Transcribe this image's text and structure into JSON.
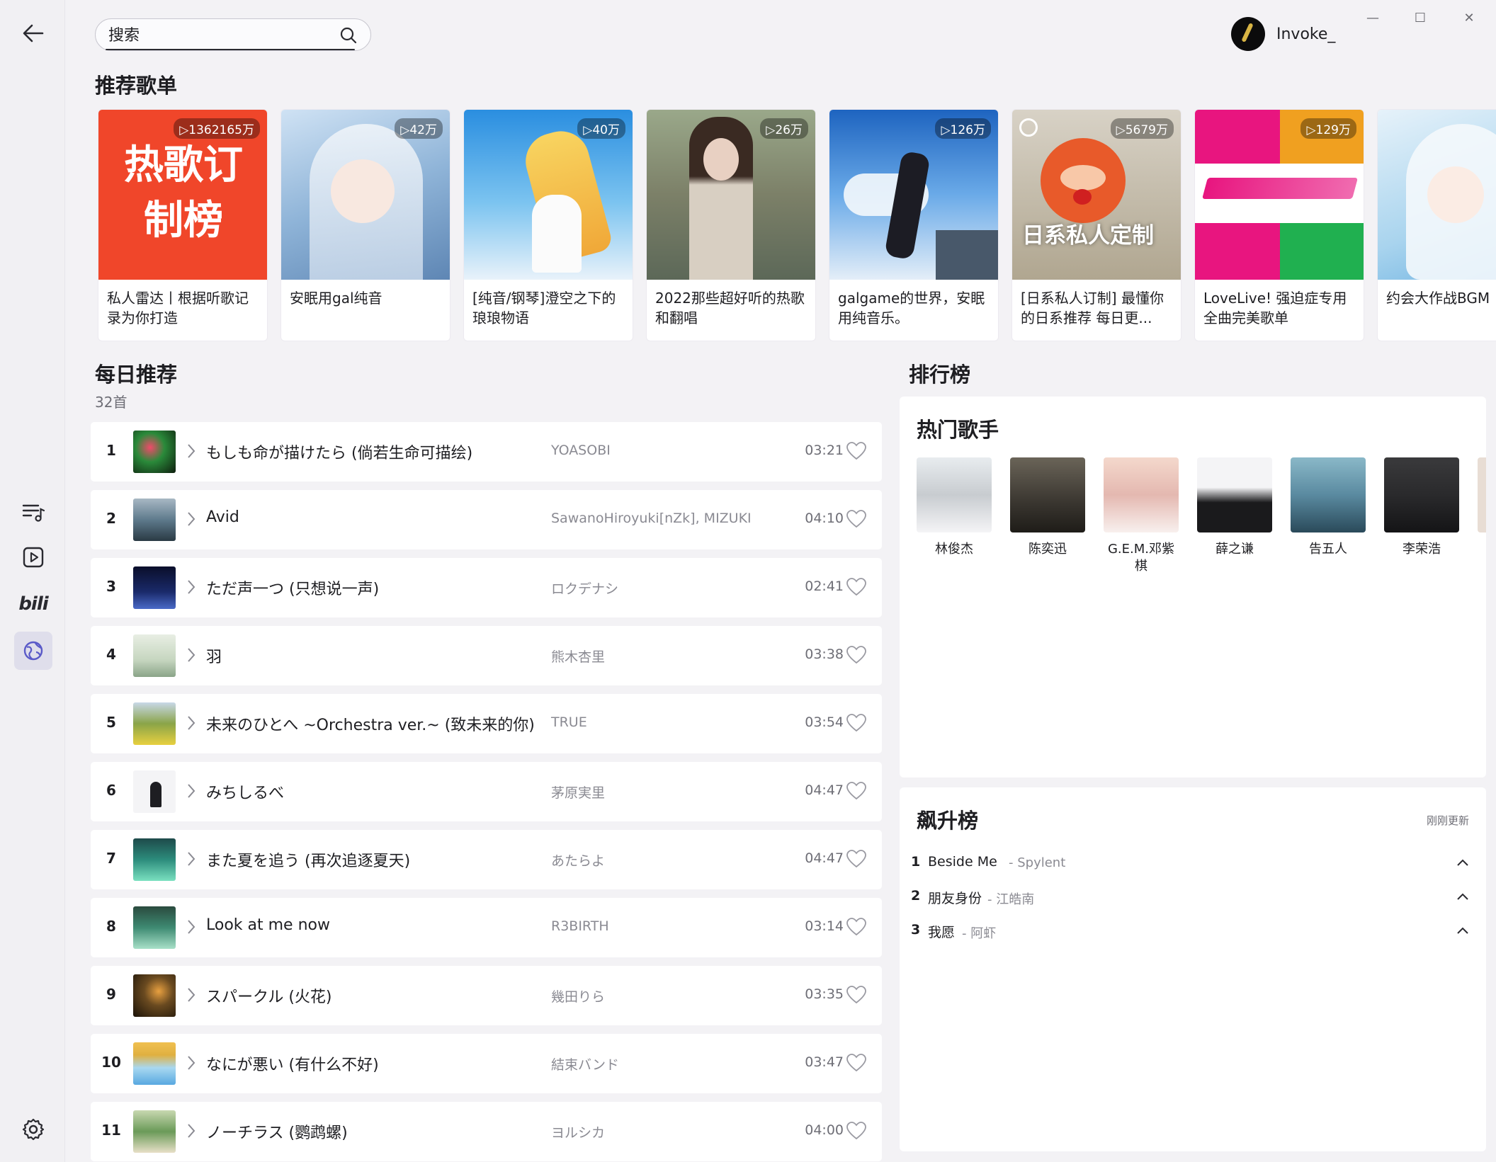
{
  "search": {
    "placeholder": "搜索"
  },
  "user": {
    "name": "Invoke_"
  },
  "window_controls": {
    "minimize": "—",
    "maximize": "☐",
    "close": "✕"
  },
  "sidebar": {
    "items": [
      {
        "name": "playlist",
        "icon": "playlist-icon"
      },
      {
        "name": "video",
        "icon": "video-icon"
      },
      {
        "name": "bilibili",
        "icon": "bili-icon",
        "text": "bili"
      },
      {
        "name": "discover",
        "icon": "planet-icon",
        "active": true
      }
    ],
    "settings_icon": "gear-icon"
  },
  "recommended": {
    "title": "推荐歌单",
    "playlists": [
      {
        "count": "▷1362165万",
        "name": "私人雷达丨根据听歌记录为你打造",
        "cover_text": "热歌订制榜",
        "cover_color": "#f0462a"
      },
      {
        "count": "▷42万",
        "name": "安眠用gal纯音",
        "cover_color": "#8fb4d8"
      },
      {
        "count": "▷40万",
        "name": "[纯音/钢琴]澄空之下的琅琅物语",
        "cover_color": "#4aa3e0"
      },
      {
        "count": "▷26万",
        "name": "2022那些超好听的热歌和翻唱",
        "cover_color": "#8a8470"
      },
      {
        "count": "▷126万",
        "name": "galgame的世界，安眠用纯音乐。",
        "cover_color": "#2f78d0"
      },
      {
        "count": "▷5679万",
        "name": "[日系私人订制] 最懂你的日系推荐 每日更...",
        "cover_text": "日系私人定制",
        "cover_color": "#c0b6a0"
      },
      {
        "count": "▷129万",
        "name": "LoveLive! 强迫症专用全曲完美歌单",
        "cover_color": "#e8157f"
      },
      {
        "count": "",
        "name": "约会大作战BGM",
        "cover_color": "#a9d4ee"
      }
    ]
  },
  "daily": {
    "title": "每日推荐",
    "count": "32首",
    "songs": [
      {
        "idx": "1",
        "title": "もしも命が描けたら (倘若生命可描绘)",
        "artist": "YOASOBI",
        "duration": "03:21",
        "thumb": "#2a5a1e"
      },
      {
        "idx": "2",
        "title": "Avid",
        "artist": "SawanoHiroyuki[nZk], MIZUKI",
        "duration": "04:10",
        "thumb": "#5e7a8c"
      },
      {
        "idx": "3",
        "title": "ただ声一つ (只想说一声)",
        "artist": "ロクデナシ",
        "duration": "02:41",
        "thumb": "#1a2a6a"
      },
      {
        "idx": "4",
        "title": "羽",
        "artist": "熊木杏里",
        "duration": "03:38",
        "thumb": "#c6d6c0"
      },
      {
        "idx": "5",
        "title": "未来のひとへ ~Orchestra ver.~ (致未来的你)",
        "artist": "TRUE",
        "duration": "03:54",
        "thumb": "#8aa448"
      },
      {
        "idx": "6",
        "title": "みちしるべ",
        "artist": "茅原実里",
        "duration": "04:47",
        "thumb": "#e8e8ea"
      },
      {
        "idx": "7",
        "title": "また夏を追う (再次追逐夏天)",
        "artist": "あたらよ",
        "duration": "04:47",
        "thumb": "#2c8c7c"
      },
      {
        "idx": "8",
        "title": "Look at me now",
        "artist": "R3BIRTH",
        "duration": "03:14",
        "thumb": "#3e8a72"
      },
      {
        "idx": "9",
        "title": "スパークル (火花)",
        "artist": "幾田りら",
        "duration": "03:35",
        "thumb": "#3a2a14"
      },
      {
        "idx": "10",
        "title": "なにが悪い (有什么不好)",
        "artist": "結束バンド",
        "duration": "03:47",
        "thumb": "#e0b040"
      },
      {
        "idx": "11",
        "title": "ノーチラス (鹦鹉螺)",
        "artist": "ヨルシカ",
        "duration": "04:00",
        "thumb": "#6a9a58"
      }
    ]
  },
  "charts": {
    "title": "排行榜",
    "hot_singers": {
      "title": "热门歌手",
      "singers": [
        {
          "name": "林俊杰",
          "color": "#c8ccd0"
        },
        {
          "name": "陈奕迅",
          "color": "#3a3630"
        },
        {
          "name": "G.E.M.邓紫棋",
          "color": "#e4b8b0"
        },
        {
          "name": "薛之谦",
          "color": "#1a1a1c"
        },
        {
          "name": "告五人",
          "color": "#5a8aa0"
        },
        {
          "name": "李荣浩",
          "color": "#2a2a2c"
        }
      ]
    },
    "rising": {
      "title": "飙升榜",
      "updated": "刚刚更新",
      "items": [
        {
          "rank": "1",
          "title": "Beside Me",
          "artist": "- Spylent"
        },
        {
          "rank": "2",
          "title": "朋友身份",
          "artist": "- 江皓南"
        },
        {
          "rank": "3",
          "title": "我愿",
          "artist": "- 阿虾"
        }
      ]
    }
  },
  "colors": {
    "accent": "#5a5ac8",
    "background": "#f3f2f5",
    "card": "#ffffff"
  }
}
